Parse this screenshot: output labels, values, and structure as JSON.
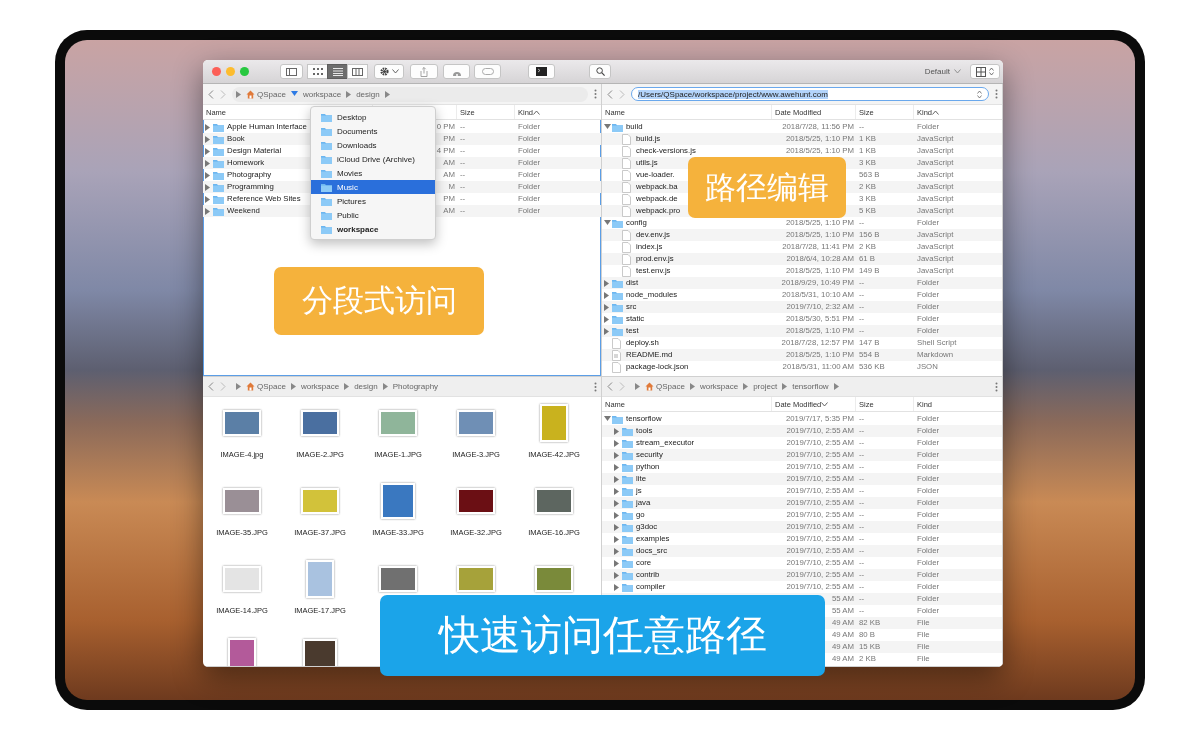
{
  "toolbar": {
    "view_modes": [
      {
        "kind": "icons",
        "selected": false
      },
      {
        "kind": "list",
        "selected": true
      },
      {
        "kind": "columns",
        "selected": false
      }
    ],
    "arrange": "Default"
  },
  "panes": [
    {
      "kind": "list",
      "focused": true,
      "path": {
        "kind": "breadcrumb",
        "segments": [
          {
            "label": "QSpace",
            "home": true,
            "chevron": true,
            "expanded": true
          },
          {
            "label": "workspace",
            "chevron": true,
            "expanded": false
          },
          {
            "label": "design",
            "chevron": true,
            "expanded": false
          }
        ]
      },
      "columns": [
        {
          "label": "Name",
          "sorted": false
        },
        {
          "sorted": false
        },
        {
          "label": "Size",
          "sorted": false
        },
        {
          "label": "Kind",
          "sorted": true,
          "ascending": true
        }
      ],
      "rows": [
        {
          "kind": "folder",
          "expanded": false,
          "name": "Apple Human Interface",
          "date": "0 PM",
          "size": "--",
          "kind_label": "Folder"
        },
        {
          "kind": "folder",
          "expanded": false,
          "name": "Book",
          "date": "PM",
          "size": "--",
          "kind_label": "Folder"
        },
        {
          "kind": "folder",
          "expanded": false,
          "name": "Design Material",
          "date": "4 PM",
          "size": "--",
          "kind_label": "Folder"
        },
        {
          "kind": "folder",
          "expanded": false,
          "name": "Homework",
          "date": "AM",
          "size": "--",
          "kind_label": "Folder"
        },
        {
          "kind": "folder",
          "expanded": false,
          "name": "Photography",
          "date": "AM",
          "size": "--",
          "kind_label": "Folder"
        },
        {
          "kind": "folder",
          "expanded": false,
          "name": "Programming",
          "date": "M",
          "size": "--",
          "kind_label": "Folder"
        },
        {
          "kind": "folder",
          "expanded": false,
          "name": "Reference Web Sites",
          "date": "PM",
          "size": "--",
          "kind_label": "Folder"
        },
        {
          "kind": "folder",
          "expanded": false,
          "name": "Weekend",
          "date": "AM",
          "size": "--",
          "kind_label": "Folder"
        }
      ],
      "menu": {
        "items": [
          {
            "label": "Desktop",
            "selected": false,
            "current": false
          },
          {
            "label": "Documents",
            "selected": false,
            "current": false
          },
          {
            "label": "Downloads",
            "selected": false,
            "current": false
          },
          {
            "label": "iCloud Drive (Archive)",
            "selected": false,
            "current": false
          },
          {
            "label": "Movies",
            "selected": false,
            "current": false
          },
          {
            "label": "Music",
            "selected": true,
            "current": false
          },
          {
            "label": "Pictures",
            "selected": false,
            "current": false
          },
          {
            "label": "Public",
            "selected": false,
            "current": false
          },
          {
            "label": "workspace",
            "selected": false,
            "current": true
          }
        ]
      }
    },
    {
      "kind": "list",
      "focused": false,
      "path": {
        "kind": "field",
        "value": "/Users/QSpace/workspace/project/www.awehunt.com",
        "text_selected": true
      },
      "columns": [
        {
          "label": "Name",
          "sorted": false
        },
        {
          "label": "Date Modified",
          "sorted": false
        },
        {
          "label": "Size",
          "sorted": false
        },
        {
          "label": "Kind",
          "sorted": true,
          "ascending": true
        }
      ],
      "rows": [
        {
          "kind": "folder",
          "expanded": true,
          "name": "build",
          "date": "2018/7/28, 11:56 PM",
          "size": "--",
          "kind_label": "Folder",
          "children": [
            {
              "kind": "file",
              "name": "build.js",
              "date": "2018/5/25, 1:10 PM",
              "size": "1 KB",
              "kind_label": "JavaScript"
            },
            {
              "kind": "file",
              "name": "check-versions.js",
              "date": "2018/5/25, 1:10 PM",
              "size": "1 KB",
              "kind_label": "JavaScript"
            },
            {
              "kind": "file",
              "name": "utils.js",
              "size": "3 KB",
              "kind_label": "JavaScript"
            },
            {
              "kind": "file",
              "name": "vue-loader.",
              "size": "563 B",
              "kind_label": "JavaScript"
            },
            {
              "kind": "file",
              "name": "webpack.ba",
              "size": "2 KB",
              "kind_label": "JavaScript"
            },
            {
              "kind": "file",
              "name": "webpack.de",
              "size": "3 KB",
              "kind_label": "JavaScript"
            },
            {
              "kind": "file",
              "name": "webpack.pro",
              "size": "5 KB",
              "kind_label": "JavaScript"
            }
          ]
        },
        {
          "kind": "folder",
          "expanded": true,
          "name": "config",
          "date": "2018/5/25, 1:10 PM",
          "size": "--",
          "kind_label": "Folder",
          "children": [
            {
              "kind": "file",
              "name": "dev.env.js",
              "date": "2018/5/25, 1:10 PM",
              "size": "156 B",
              "kind_label": "JavaScript"
            },
            {
              "kind": "file",
              "name": "index.js",
              "date": "2018/7/28, 11:41 PM",
              "size": "2 KB",
              "kind_label": "JavaScript"
            },
            {
              "kind": "file",
              "name": "prod.env.js",
              "date": "2018/6/4, 10:28 AM",
              "size": "61 B",
              "kind_label": "JavaScript"
            },
            {
              "kind": "file",
              "name": "test.env.js",
              "date": "2018/5/25, 1:10 PM",
              "size": "149 B",
              "kind_label": "JavaScript"
            }
          ]
        },
        {
          "kind": "folder",
          "expanded": false,
          "name": "dist",
          "date": "2018/9/29, 10:49 PM",
          "size": "--",
          "kind_label": "Folder"
        },
        {
          "kind": "folder",
          "expanded": false,
          "name": "node_modules",
          "date": "2018/5/31, 10:10 AM",
          "size": "--",
          "kind_label": "Folder"
        },
        {
          "kind": "folder",
          "expanded": false,
          "name": "src",
          "date": "2019/7/10, 2:32 AM",
          "size": "--",
          "kind_label": "Folder"
        },
        {
          "kind": "folder",
          "expanded": false,
          "name": "static",
          "date": "2018/5/30, 5:51 PM",
          "size": "--",
          "kind_label": "Folder"
        },
        {
          "kind": "folder",
          "expanded": false,
          "name": "test",
          "date": "2018/5/25, 1:10 PM",
          "size": "--",
          "kind_label": "Folder"
        },
        {
          "kind": "file",
          "name": "deploy.sh",
          "date": "2018/7/28, 12:57 PM",
          "size": "147 B",
          "kind_label": "Shell Script"
        },
        {
          "kind": "markdown",
          "name": "README.md",
          "date": "2018/5/25, 1:10 PM",
          "size": "554 B",
          "kind_label": "Markdown"
        },
        {
          "kind": "file",
          "name": "package-lock.json",
          "date": "2018/5/31, 11:00 AM",
          "size": "536 KB",
          "kind_label": "JSON"
        }
      ]
    },
    {
      "kind": "icons",
      "focused": false,
      "path": {
        "kind": "breadcrumb",
        "segments": [
          {
            "label": "QSpace",
            "home": true,
            "chevron": true,
            "expanded": false
          },
          {
            "label": "workspace",
            "chevron": true,
            "expanded": false
          },
          {
            "label": "design",
            "chevron": true,
            "expanded": false
          },
          {
            "label": "Photography",
            "chevron": false
          }
        ]
      },
      "items": [
        {
          "label": "IMAGE-4.jpg",
          "kind": "landscape",
          "color": "#5b7fa6"
        },
        {
          "label": "IMAGE-2.JPG",
          "kind": "landscape",
          "color": "#4a6fa0"
        },
        {
          "label": "IMAGE-1.JPG",
          "kind": "landscape",
          "color": "#8fb59a"
        },
        {
          "label": "IMAGE-3.JPG",
          "kind": "landscape",
          "color": "#6f8fb5"
        },
        {
          "label": "IMAGE-42.JPG",
          "kind": "portrait",
          "color": "#c9b21e"
        },
        {
          "label": "IMAGE-35.JPG",
          "kind": "landscape",
          "color": "#9a8f96"
        },
        {
          "label": "IMAGE-37.JPG",
          "kind": "landscape",
          "color": "#d2c23a"
        },
        {
          "label": "IMAGE-33.JPG",
          "kind": "square",
          "color": "#3a78c0"
        },
        {
          "label": "IMAGE-32.JPG",
          "kind": "landscape",
          "color": "#6b0f14"
        },
        {
          "label": "IMAGE-16.JPG",
          "kind": "landscape",
          "color": "#5d6660"
        },
        {
          "label": "IMAGE-14.JPG",
          "kind": "landscape",
          "color": "#e4e4e4"
        },
        {
          "label": "IMAGE-17.JPG",
          "kind": "portrait",
          "color": "#a9c2e0"
        },
        {
          "kind": "landscape",
          "color": "#707070"
        },
        {
          "kind": "landscape",
          "color": "#a6a23a"
        },
        {
          "kind": "landscape",
          "color": "#7a8a3a"
        },
        {
          "kind": "portrait",
          "color": "#b35a9a"
        },
        {
          "kind": "square",
          "color": "#4a3a2e"
        }
      ]
    },
    {
      "kind": "list",
      "focused": false,
      "path": {
        "kind": "breadcrumb",
        "segments": [
          {
            "label": "QSpace",
            "home": true,
            "chevron": true,
            "expanded": false
          },
          {
            "label": "workspace",
            "chevron": true,
            "expanded": false
          },
          {
            "label": "project",
            "chevron": true,
            "expanded": false
          },
          {
            "label": "tensorflow",
            "chevron": true,
            "expanded": false
          }
        ]
      },
      "columns": [
        {
          "label": "Name",
          "sorted": false
        },
        {
          "label": "Date Modified",
          "sorted": true,
          "ascending": false
        },
        {
          "label": "Size",
          "sorted": false
        },
        {
          "label": "Kind",
          "sorted": false
        }
      ],
      "rows": [
        {
          "kind": "folder",
          "expanded": true,
          "name": "tensorflow",
          "date": "2019/7/17, 5:35 PM",
          "size": "--",
          "kind_label": "Folder",
          "children": [
            {
              "kind": "folder",
              "expanded": false,
              "name": "tools",
              "date": "2019/7/10, 2:55 AM",
              "size": "--",
              "kind_label": "Folder"
            },
            {
              "kind": "folder",
              "expanded": false,
              "name": "stream_executor",
              "date": "2019/7/10, 2:55 AM",
              "size": "--",
              "kind_label": "Folder"
            },
            {
              "kind": "folder",
              "expanded": false,
              "name": "security",
              "date": "2019/7/10, 2:55 AM",
              "size": "--",
              "kind_label": "Folder"
            },
            {
              "kind": "folder",
              "expanded": false,
              "name": "python",
              "date": "2019/7/10, 2:55 AM",
              "size": "--",
              "kind_label": "Folder"
            },
            {
              "kind": "folder",
              "expanded": false,
              "name": "lite",
              "date": "2019/7/10, 2:55 AM",
              "size": "--",
              "kind_label": "Folder"
            },
            {
              "kind": "folder",
              "expanded": false,
              "name": "js",
              "date": "2019/7/10, 2:55 AM",
              "size": "--",
              "kind_label": "Folder"
            },
            {
              "kind": "folder",
              "expanded": false,
              "name": "java",
              "date": "2019/7/10, 2:55 AM",
              "size": "--",
              "kind_label": "Folder"
            },
            {
              "kind": "folder",
              "expanded": false,
              "name": "go",
              "date": "2019/7/10, 2:55 AM",
              "size": "--",
              "kind_label": "Folder"
            },
            {
              "kind": "folder",
              "expanded": false,
              "name": "g3doc",
              "date": "2019/7/10, 2:55 AM",
              "size": "--",
              "kind_label": "Folder"
            },
            {
              "kind": "folder",
              "expanded": false,
              "name": "examples",
              "date": "2019/7/10, 2:55 AM",
              "size": "--",
              "kind_label": "Folder"
            },
            {
              "kind": "folder",
              "expanded": false,
              "name": "docs_src",
              "date": "2019/7/10, 2:55 AM",
              "size": "--",
              "kind_label": "Folder"
            },
            {
              "kind": "folder",
              "expanded": false,
              "name": "core",
              "date": "2019/7/10, 2:55 AM",
              "size": "--",
              "kind_label": "Folder"
            },
            {
              "kind": "folder",
              "expanded": false,
              "name": "contrib",
              "date": "2019/7/10, 2:55 AM",
              "size": "--",
              "kind_label": "Folder"
            },
            {
              "kind": "folder",
              "expanded": false,
              "name": "compiler",
              "date": "2019/7/10, 2:55 AM",
              "size": "--",
              "kind_label": "Folder"
            },
            {
              "date": "55 AM",
              "size": "--",
              "kind_label": "Folder"
            },
            {
              "date": "55 AM",
              "size": "--",
              "kind_label": "Folder"
            },
            {
              "date": "49 AM",
              "size": "82 KB",
              "kind_label": "File"
            },
            {
              "date": "49 AM",
              "size": "80 B",
              "kind_label": "File"
            },
            {
              "date": "49 AM",
              "size": "15 KB",
              "kind_label": "File"
            },
            {
              "date": "49 AM",
              "size": "2 KB",
              "kind_label": "File"
            }
          ]
        }
      ]
    }
  ],
  "callouts": [
    {
      "text": "分段式访问",
      "color": "#f5b23c"
    },
    {
      "text": "路径编辑",
      "color": "#f5b23c"
    },
    {
      "text": "快速访问任意路径",
      "color": "#1ba4e9"
    }
  ]
}
